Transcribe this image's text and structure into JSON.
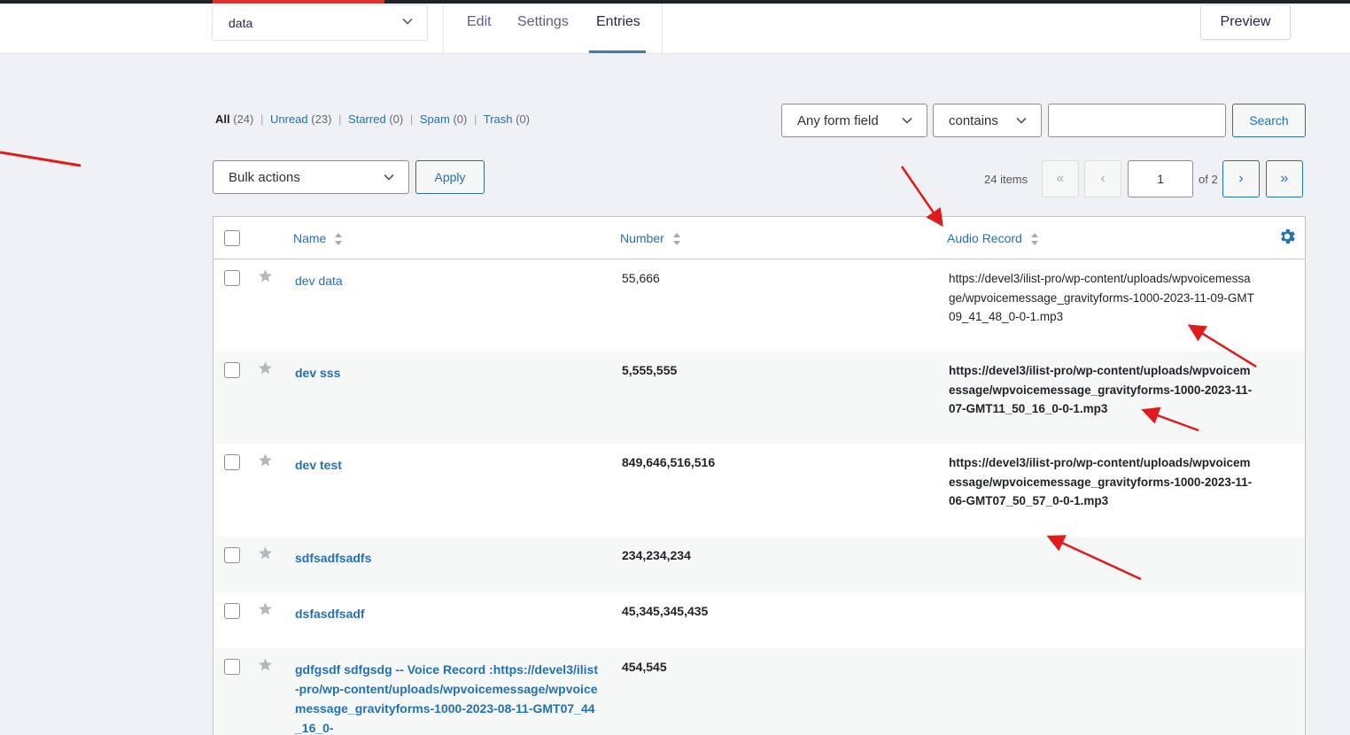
{
  "header": {
    "form_select_value": "data",
    "tabs": [
      {
        "label": "Edit"
      },
      {
        "label": "Settings"
      },
      {
        "label": "Entries"
      }
    ],
    "preview_label": "Preview"
  },
  "filters": {
    "all": {
      "label": "All",
      "count": "(24)"
    },
    "unread": {
      "label": "Unread",
      "count": "(23)"
    },
    "starred": {
      "label": "Starred",
      "count": "(0)"
    },
    "spam": {
      "label": "Spam",
      "count": "(0)"
    },
    "trash": {
      "label": "Trash",
      "count": "(0)"
    }
  },
  "search": {
    "field_value": "Any form field",
    "operator_value": "contains",
    "query": "",
    "button_label": "Search"
  },
  "bulk": {
    "select_value": "Bulk actions",
    "apply_label": "Apply"
  },
  "pagination": {
    "items_label": "24 items",
    "first": "«",
    "prev": "‹",
    "current_page": "1",
    "of_label": "of 2",
    "next": "›",
    "last": "»"
  },
  "table": {
    "columns": {
      "name": "Name",
      "number": "Number",
      "audio": "Audio Record"
    },
    "rows": [
      {
        "name": "dev data",
        "number": "55,666",
        "audio": "https://devel3/ilist-pro/wp-content/uploads/wpvoicemessage/wpvoicemessage_gravityforms-1000-2023-11-09-GMT09_41_48_0-0-1.mp3"
      },
      {
        "name": "dev sss",
        "number": "5,555,555",
        "audio": "https://devel3/ilist-pro/wp-content/uploads/wpvoicemessage/wpvoicemessage_gravityforms-1000-2023-11-07-GMT11_50_16_0-0-1.mp3"
      },
      {
        "name": "dev test",
        "number": "849,646,516,516",
        "audio": "https://devel3/ilist-pro/wp-content/uploads/wpvoicemessage/wpvoicemessage_gravityforms-1000-2023-11-06-GMT07_50_57_0-0-1.mp3"
      },
      {
        "name": "sdfsadfsadfs",
        "number": "234,234,234",
        "audio": ""
      },
      {
        "name": "dsfasdfsadf",
        "number": "45,345,345,435",
        "audio": ""
      },
      {
        "name": "gdfgsdf sdfgsdg -- Voice Record :https://devel3/ilist-pro/wp-content/uploads/wpvoicemessage/wpvoicemessage_gravityforms-1000-2023-08-11-GMT07_44_16_0-",
        "number": "454,545",
        "audio": ""
      }
    ]
  },
  "colors": {
    "link": "#2271b1",
    "annotation_arrow": "#e01b1b",
    "header_accent": "#e2302b"
  }
}
